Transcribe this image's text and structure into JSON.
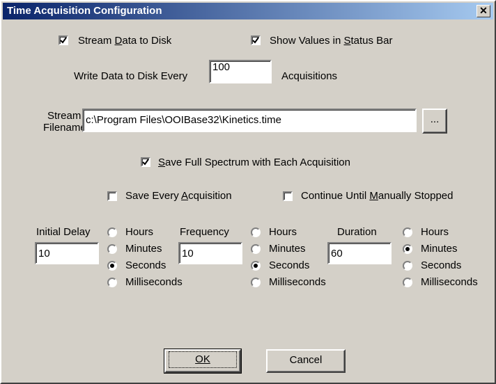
{
  "window": {
    "title": "Time Acquisition Configuration",
    "close_glyph": "✕"
  },
  "stream": {
    "to_disk": {
      "label_pre": "Stream ",
      "label_u": "D",
      "label_post": "ata to Disk",
      "checked": true
    },
    "status_bar": {
      "label_pre": "Show Values in ",
      "label_u": "S",
      "label_post": "tatus Bar",
      "checked": true
    },
    "write_every_label": "Write Data to Disk Every",
    "write_every_value": "100",
    "acquisitions_label": "Acquisitions",
    "filename_label_line1": "Stream",
    "filename_label_line2": "Filename",
    "filename_value": "c:\\Program Files\\OOIBase32\\Kinetics.time",
    "browse_label": "..."
  },
  "options": {
    "full_spectrum": {
      "label_u": "S",
      "label_post": "ave Full Spectrum with Each Acquisition",
      "checked": true
    },
    "every_acquisition": {
      "label_pre": "Save Every ",
      "label_u": "A",
      "label_post": "cquisition",
      "checked": false
    },
    "until_stopped": {
      "label_pre": "Continue Until ",
      "label_u": "M",
      "label_post": "anually Stopped",
      "checked": false
    }
  },
  "timing": {
    "unit_labels": [
      "Hours",
      "Minutes",
      "Seconds",
      "Milliseconds"
    ],
    "initial_delay": {
      "label": "Initial Delay",
      "value": "10",
      "selected": "Seconds"
    },
    "frequency": {
      "label": "Frequency",
      "value": "10",
      "selected": "Seconds"
    },
    "duration": {
      "label": "Duration",
      "value": "60",
      "selected": "Minutes"
    }
  },
  "buttons": {
    "ok": "OK",
    "cancel": "Cancel"
  }
}
